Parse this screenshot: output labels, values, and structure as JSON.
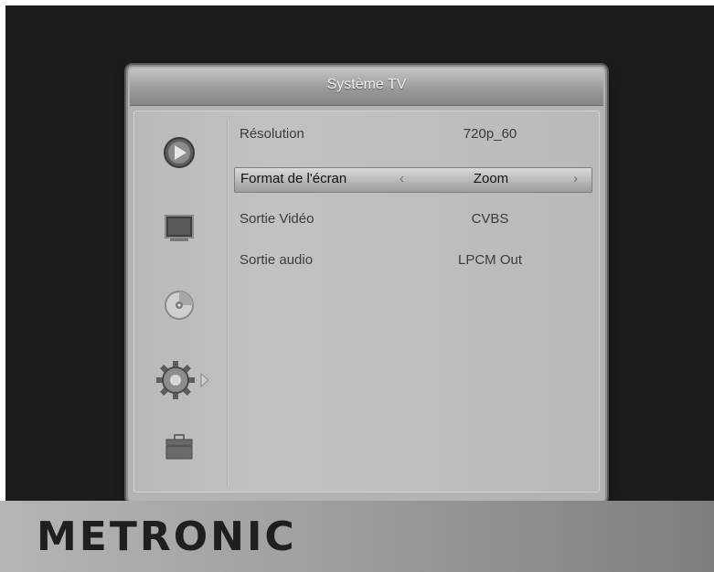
{
  "dialog": {
    "title": "Système TV"
  },
  "sidebar": {
    "items": [
      {
        "icon": "play-icon"
      },
      {
        "icon": "monitor-icon"
      },
      {
        "icon": "disc-icon"
      },
      {
        "icon": "gear-icon",
        "active": true
      },
      {
        "icon": "briefcase-icon"
      }
    ]
  },
  "settings": [
    {
      "label": "Résolution",
      "value": "720p_60"
    },
    {
      "label": "Format de l'écran",
      "value": "Zoom",
      "selected": true
    },
    {
      "label": "Sortie Vidéo",
      "value": "CVBS"
    },
    {
      "label": "Sortie audio",
      "value": "LPCM Out"
    }
  ],
  "nav": {
    "left_arrow": "‹",
    "right_arrow": "›"
  },
  "brand": {
    "name": "METRONIC"
  }
}
